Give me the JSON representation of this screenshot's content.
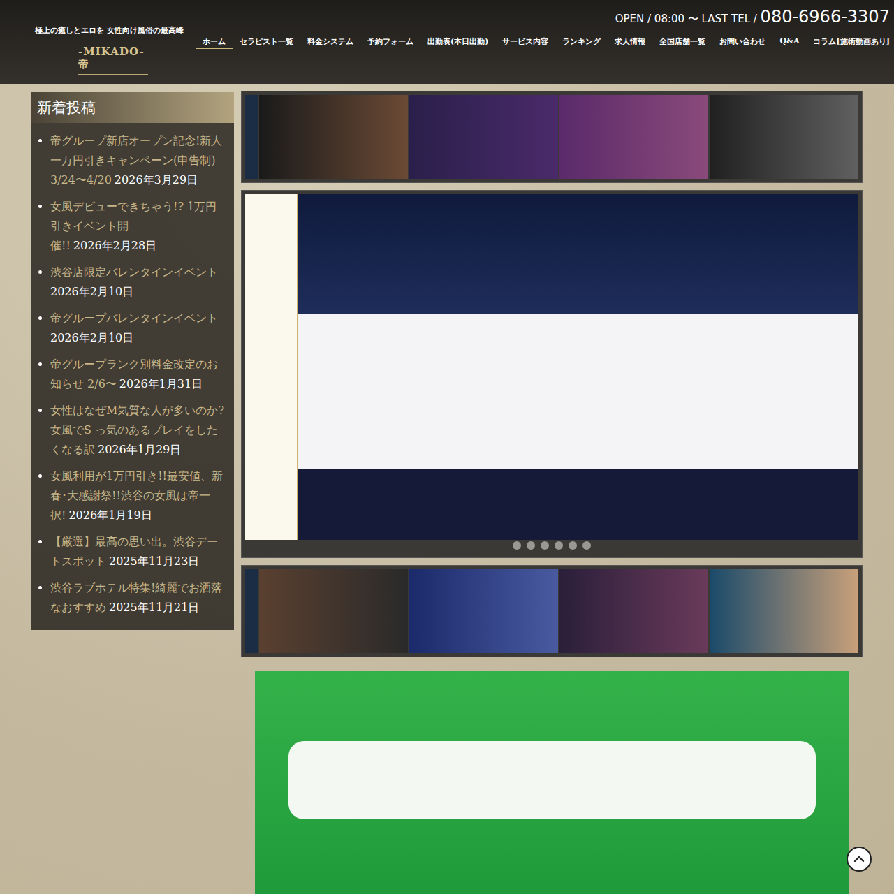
{
  "header": {
    "tagline": "極上の癒しとエロを 女性向け風俗の最高峰",
    "logo": "-MIKADO-帝",
    "open_label": "OPEN / 08:00 〜 LAST TEL / ",
    "phone": "080-6966-3307"
  },
  "nav": [
    {
      "label": "ホーム",
      "selected": true
    },
    {
      "label": "セラピスト一覧",
      "selected": false
    },
    {
      "label": "料金システム",
      "selected": false
    },
    {
      "label": "予約フォーム",
      "selected": false
    },
    {
      "label": "出勤表(本日出勤)",
      "selected": false
    },
    {
      "label": "サービス内容",
      "selected": false
    },
    {
      "label": "ランキング",
      "selected": false
    },
    {
      "label": "求人情報",
      "selected": false
    },
    {
      "label": "全国店舗一覧",
      "selected": false
    },
    {
      "label": "お問い合わせ",
      "selected": false
    },
    {
      "label": "Q&A",
      "selected": false
    },
    {
      "label": "コラム[施術動画あり]",
      "selected": false
    }
  ],
  "sidebar": {
    "title": "新着投稿",
    "posts": [
      {
        "title": "帝グループ新店オープン記念!新人一万円引きキャンペーン(申告制) 3/24〜4/20",
        "date": "2026年3月29日"
      },
      {
        "title": "女風デビューできちゃう!? 1万円引きイベント開催!!",
        "date": "2026年2月28日"
      },
      {
        "title": "渋谷店限定バレンタインイベント",
        "date": "2026年2月10日"
      },
      {
        "title": "帝グループバレンタインイベント",
        "date": "2026年2月10日"
      },
      {
        "title": "帝グループランク別料金改定のお知らせ 2/6〜",
        "date": "2026年1月31日"
      },
      {
        "title": "女性はなぜM気質な人が多いのか?女風でS っ気のあるプレイをしたくなる訳",
        "date": "2026年1月29日"
      },
      {
        "title": "女風利用が1万円引き!!最安値、新春･大感謝祭!!渋谷の女風は帝一択!",
        "date": "2026年1月19日"
      },
      {
        "title": "【厳選】最高の思い出。渋谷デートスポット",
        "date": "2025年11月23日"
      },
      {
        "title": "渋谷ラブホテル特集!綺麗でお洒落なおすすめ",
        "date": "2025年11月21日"
      }
    ]
  },
  "slider": {
    "dots": [
      {
        "selected": false
      },
      {
        "selected": false
      },
      {
        "selected": false
      },
      {
        "selected": false
      },
      {
        "selected": false
      },
      {
        "selected": false
      }
    ]
  }
}
